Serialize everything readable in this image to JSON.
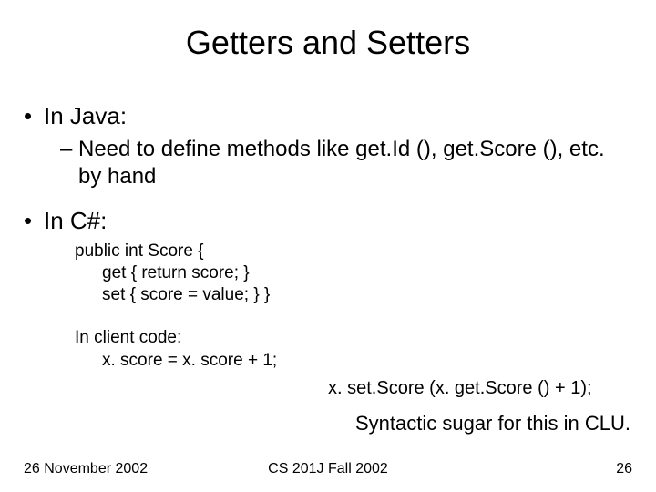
{
  "title": "Getters and Setters",
  "bullets": {
    "java": {
      "heading": "In Java:",
      "sub": "Need to define methods like get.Id (), get.Score (), etc. by hand"
    },
    "csharp": {
      "heading": "In C#:",
      "code": {
        "line1": "public int Score {",
        "line2": "get { return score; }",
        "line3": "set { score = value; } }"
      },
      "client": {
        "label": "In client code:",
        "line": "x. score = x. score + 1;"
      },
      "equivalent": "x. set.Score (x. get.Score () + 1);"
    }
  },
  "sugar_note": "Syntactic sugar for this in CLU.",
  "footer": {
    "date": "26 November 2002",
    "course": "CS 201J Fall 2002",
    "page": "26"
  }
}
